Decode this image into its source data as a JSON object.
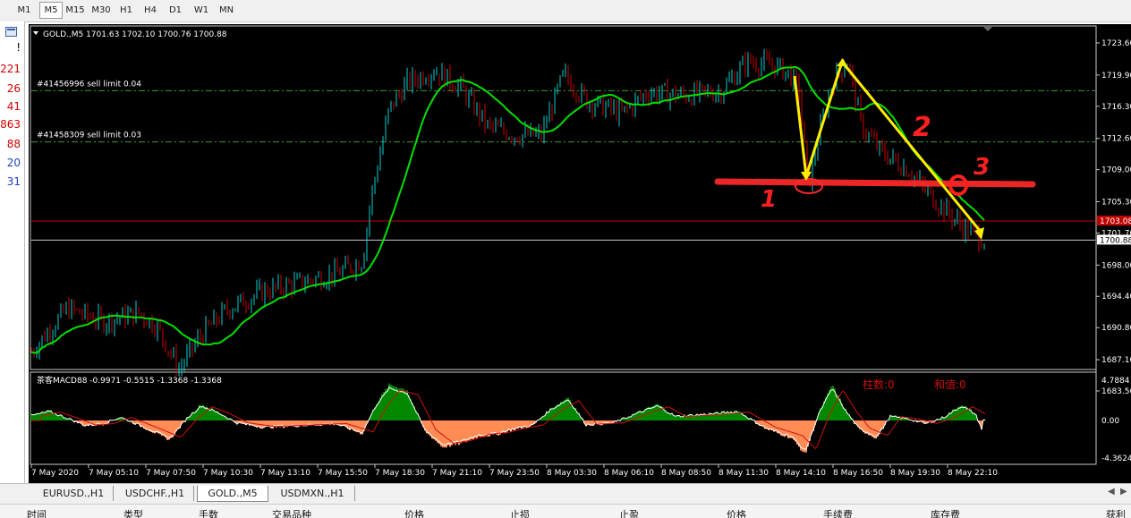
{
  "toolbar": {
    "timeframes": [
      "M1",
      "M5",
      "M15",
      "M30",
      "H1",
      "H4",
      "D1",
      "W1",
      "MN"
    ],
    "active": "M5"
  },
  "left_panel": {
    "icon": "chart-icon",
    "items": [
      {
        "text": "!",
        "color": "#000000"
      },
      {
        "text": "221",
        "color": "#d00000"
      },
      {
        "text": "26",
        "color": "#d00000"
      },
      {
        "text": "41",
        "color": "#d00000"
      },
      {
        "text": "863",
        "color": "#d00000"
      },
      {
        "text": "88",
        "color": "#d00000"
      },
      {
        "text": "20",
        "color": "#1f3fbf"
      },
      {
        "text": "31",
        "color": "#1f3fbf"
      }
    ]
  },
  "chart": {
    "header": "GOLD.,M5  1701.63 1702.10 1700.76 1700.88",
    "order_lines": [
      {
        "label": "#41456996 sell limit 0.04",
        "price": 1718.1
      },
      {
        "label": "#41458309 sell limit 0.03",
        "price": 1712.2
      }
    ],
    "price_ticks": [
      "1723.60",
      "1719.90",
      "1716.30",
      "1712.60",
      "1709.00",
      "1705.30",
      "1701.70",
      "1698.00",
      "1694.40",
      "1690.80",
      "1687.10",
      "1683.50"
    ],
    "tags": {
      "ask": "1703.08",
      "bid": "1700.88"
    },
    "annotations": [
      "1",
      "2",
      "3"
    ],
    "macd": {
      "label": "茶客MACD88 -0.9971 -0.5515 -1.3368 -1.3368",
      "stats": [
        "柱数:0",
        "和值:0"
      ],
      "ticks": [
        "4.7884",
        "0.00",
        "-4.3624"
      ]
    },
    "time_ticks": [
      "7 May 2020",
      "7 May 05:10",
      "7 May 07:50",
      "7 May 10:30",
      "7 May 13:10",
      "7 May 15:50",
      "7 May 18:30",
      "7 May 21:10",
      "7 May 23:50",
      "8 May 03:30",
      "8 May 06:10",
      "8 May 08:50",
      "8 May 11:30",
      "8 May 14:10",
      "8 May 16:50",
      "8 May 19:30",
      "8 May 22:10"
    ],
    "colors": {
      "bull": "#00d0d0",
      "bear": "#d00000",
      "ma": "#00e000",
      "macd_pos": "#008800",
      "macd_neg": "#ff8c55",
      "order": "#3c9a3c"
    }
  },
  "symbol_tabs": {
    "items": [
      "EURUSD.,H1",
      "USDCHF.,H1",
      "GOLD.,M5",
      "USDMXN.,H1"
    ],
    "active": "GOLD.,M5"
  },
  "bottom_headers": [
    "时间",
    "类型",
    "手数",
    "交易品种",
    "价格",
    "止损",
    "止盈",
    "价格",
    "手续费",
    "库存费",
    "获利"
  ]
}
